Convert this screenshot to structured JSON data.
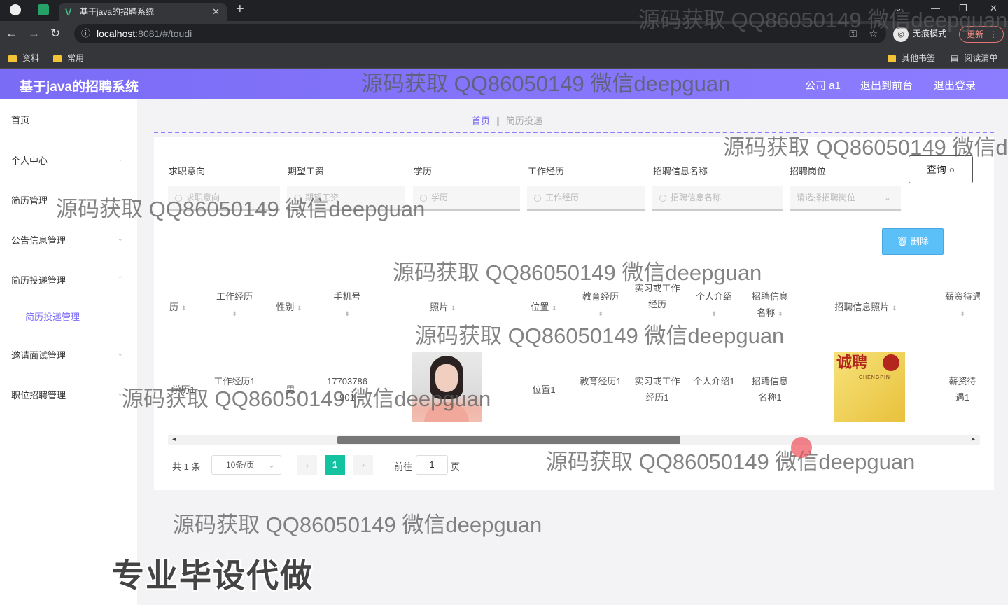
{
  "browser": {
    "tab_title": "基于java的招聘系统",
    "url_host": "localhost",
    "url_path": ":8081/#/toudi",
    "incognito_label": "无痕模式",
    "update_label": "更新",
    "bookmarks": [
      "资料",
      "常用"
    ],
    "bookmarks_right": [
      "其他书签",
      "阅读清单"
    ]
  },
  "header": {
    "title": "基于java的招聘系统",
    "user": "公司 a1",
    "back_front": "退出到前台",
    "logout": "退出登录"
  },
  "sidebar": {
    "items": [
      "首页",
      "个人中心",
      "简历管理",
      "公告信息管理",
      "简历投递管理",
      "简历投递管理",
      "邀请面试管理",
      "职位招聘管理"
    ]
  },
  "breadcrumb": {
    "home": "首页",
    "current": "简历投递"
  },
  "filters": {
    "labels": [
      "求职意向",
      "期望工资",
      "学历",
      "工作经历",
      "招聘信息名称",
      "招聘岗位"
    ],
    "placeholders": [
      "求职意向",
      "期望工资",
      "学历",
      "工作经历",
      "招聘信息名称",
      "请选择招聘岗位"
    ]
  },
  "buttons": {
    "query": "查询",
    "delete": "删除"
  },
  "table": {
    "headers": [
      "历",
      "工作经历",
      "性别",
      "手机号",
      "照片",
      "位置",
      "教育经历",
      "实习或工作经历",
      "个人介绍",
      "招聘信息名称",
      "招聘信息照片",
      "薪资待遇"
    ],
    "row": {
      "c0": "学历1",
      "work": "工作经历1",
      "gender": "男",
      "phone": "17703786901",
      "location": "位置1",
      "education": "教育经历1",
      "internship": "实习或工作经历1",
      "intro": "个人介绍1",
      "job_name": "招聘信息名称1",
      "salary": "薪资待遇1"
    },
    "poster_text": "诚聘",
    "poster_en": "CHENGPIN"
  },
  "pagination": {
    "total": "共 1 条",
    "page_size": "10条/页",
    "current": "1",
    "goto": "前往",
    "goto_value": "1",
    "page": "页"
  },
  "watermark": "源码获取 QQ86050149 微信deepguan",
  "banner": "专业毕设代做"
}
